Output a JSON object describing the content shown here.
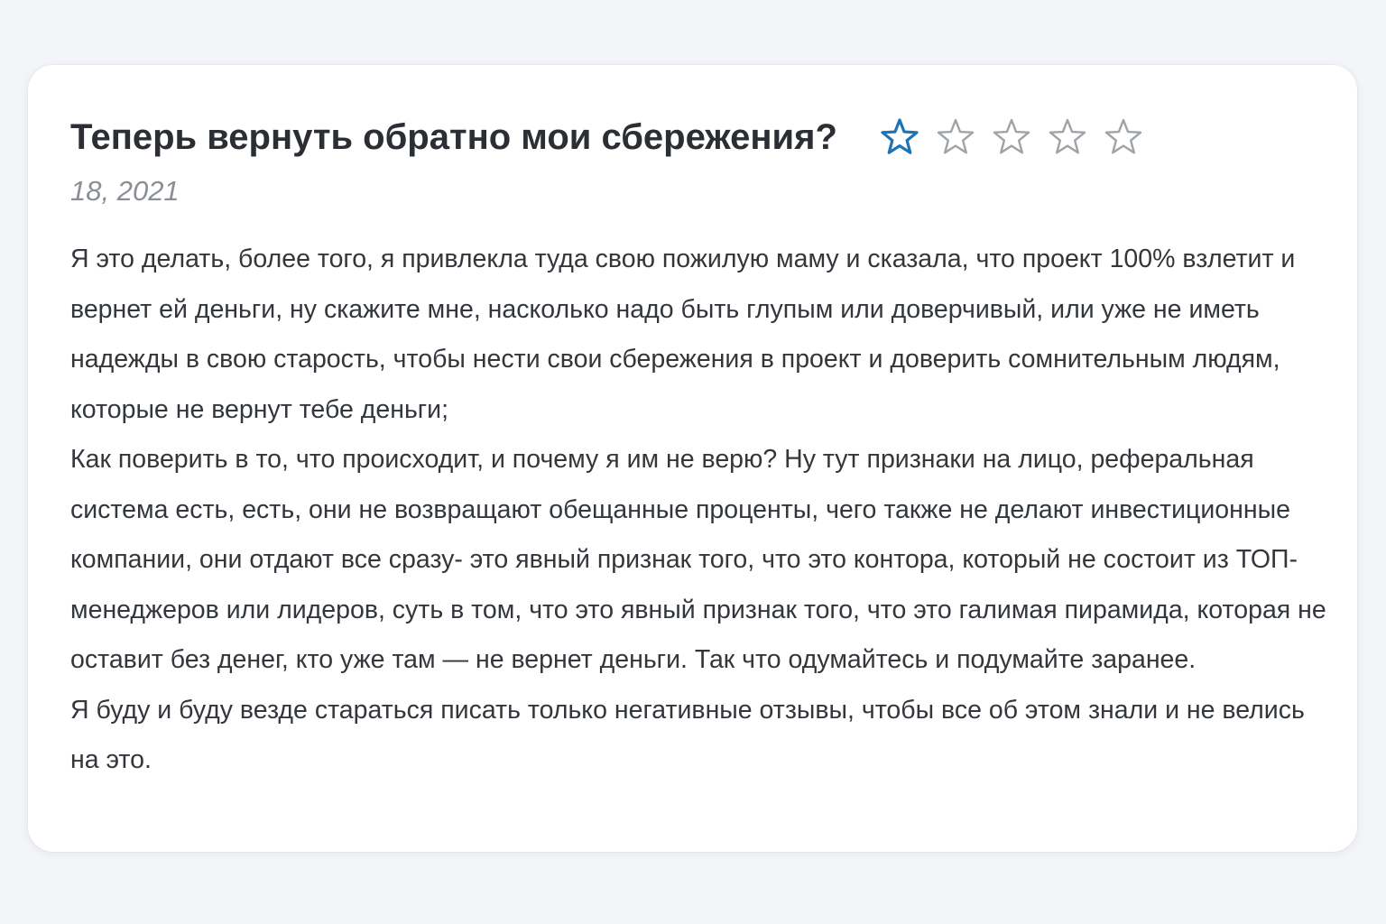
{
  "review": {
    "title": "Теперь вернуть обратно мои сбережения?",
    "date": "18, 2021",
    "rating": {
      "value": 1,
      "max": 5,
      "filled_color": "#1c74b8",
      "empty_color": "#9ea3a8"
    },
    "paragraphs": [
      "Я это делать, более того, я привлекла туда свою пожилую маму и сказала, что проект 100% взлетит и вернет ей деньги, ну скажите мне, насколько надо быть глупым или доверчивый, или уже не иметь надежды в свою старость, чтобы нести свои сбережения в проект и доверить сомнительным людям, которые не вернут тебе деньги;",
      "Как поверить в то, что происходит, и почему я им не верю? Ну тут признаки на лицо, реферальная система есть, есть, они не возвращают обещанные проценты, чего также не делают инвестиционные компании, они отдают все сразу- это явный признак того, что это контора, который не состоит из ТОП-менеджеров или лидеров, суть в том, что это явный признак того, что это галимая пирамида, которая не оставит без денег, кто уже там — не вернет деньги. Так что одумайтесь и подумайте заранее.",
      "Я буду и буду везде стараться писать только негативные отзывы, чтобы все об этом знали и не велись на это."
    ]
  }
}
